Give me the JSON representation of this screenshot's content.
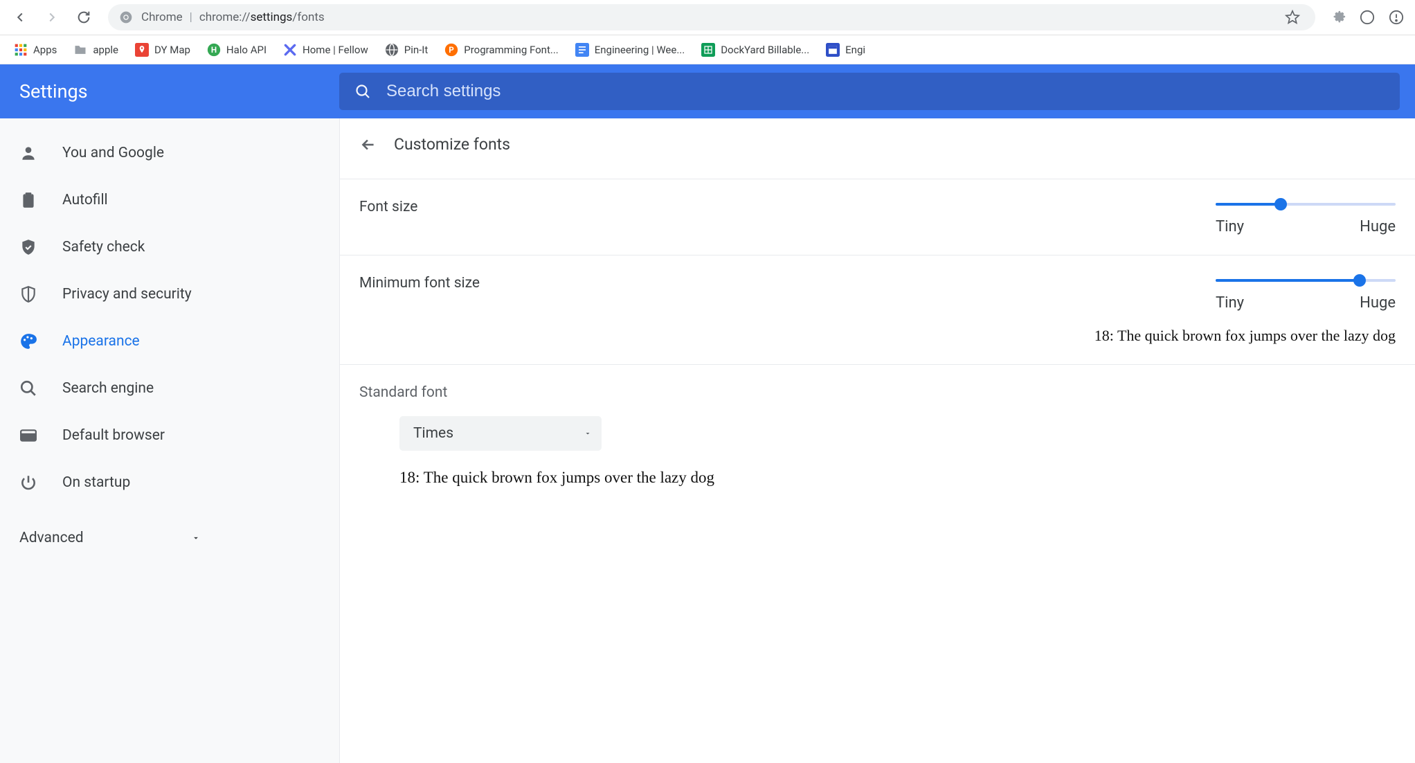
{
  "toolbar": {
    "url_prefix": "Chrome",
    "url_base": "chrome://",
    "url_bold": "settings",
    "url_tail": "/fonts"
  },
  "bookmarks": [
    {
      "label": "Apps",
      "icon": "apps"
    },
    {
      "label": "apple",
      "icon": "folder"
    },
    {
      "label": "DY Map",
      "icon": "red-pin"
    },
    {
      "label": "Halo API",
      "icon": "green-h"
    },
    {
      "label": "Home | Fellow",
      "icon": "fellow"
    },
    {
      "label": "Pin-It",
      "icon": "globe"
    },
    {
      "label": "Programming Font...",
      "icon": "orange-p"
    },
    {
      "label": "Engineering | Wee...",
      "icon": "blue-doc"
    },
    {
      "label": "DockYard Billable...",
      "icon": "green-sheet"
    },
    {
      "label": "Engi",
      "icon": "notion"
    }
  ],
  "header": {
    "title": "Settings",
    "search_placeholder": "Search settings"
  },
  "sidebar": {
    "items": [
      {
        "label": "You and Google",
        "icon": "person"
      },
      {
        "label": "Autofill",
        "icon": "clipboard"
      },
      {
        "label": "Safety check",
        "icon": "shield-check"
      },
      {
        "label": "Privacy and security",
        "icon": "shield"
      },
      {
        "label": "Appearance",
        "icon": "palette"
      },
      {
        "label": "Search engine",
        "icon": "search"
      },
      {
        "label": "Default browser",
        "icon": "browser"
      },
      {
        "label": "On startup",
        "icon": "power"
      }
    ],
    "advanced": "Advanced"
  },
  "content": {
    "page_title": "Customize fonts",
    "font_size": {
      "label": "Font size",
      "min_label": "Tiny",
      "max_label": "Huge",
      "percent": 36
    },
    "min_font_size": {
      "label": "Minimum font size",
      "min_label": "Tiny",
      "max_label": "Huge",
      "percent": 80,
      "sample": "18: The quick brown fox jumps over the lazy dog"
    },
    "standard_font": {
      "label": "Standard font",
      "value": "Times",
      "preview": "18: The quick brown fox jumps over the lazy dog"
    }
  }
}
